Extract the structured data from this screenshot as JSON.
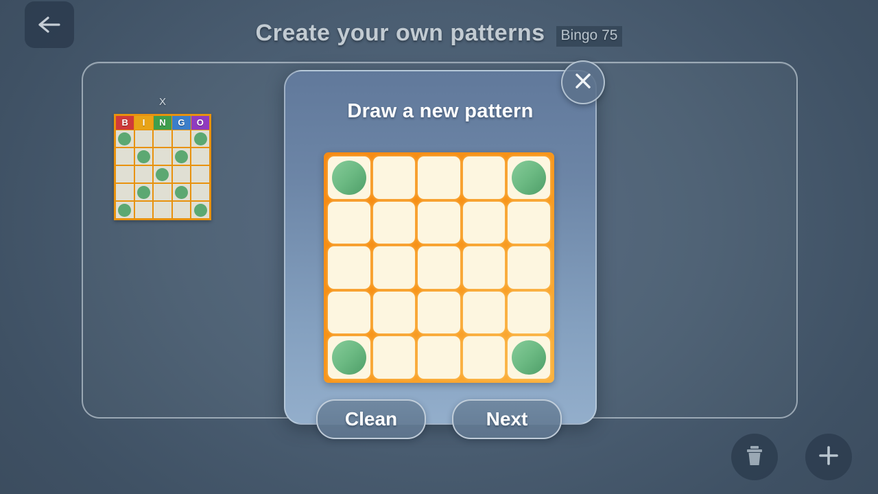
{
  "header": {
    "title": "Create your own patterns",
    "badge": "Bingo 75",
    "back_icon": "arrow-left-icon"
  },
  "saved_patterns": [
    {
      "name": "X",
      "columns": [
        "B",
        "I",
        "N",
        "G",
        "O"
      ],
      "column_colors": [
        "#cf3a3a",
        "#e8a317",
        "#3f9e4d",
        "#3b7ec9",
        "#8f3bbf"
      ],
      "cells": [
        [
          1,
          0,
          0,
          0,
          1
        ],
        [
          0,
          1,
          0,
          1,
          0
        ],
        [
          0,
          0,
          1,
          0,
          0
        ],
        [
          0,
          1,
          0,
          1,
          0
        ],
        [
          1,
          0,
          0,
          0,
          1
        ]
      ]
    }
  ],
  "dialog": {
    "title": "Draw a new pattern",
    "close_icon": "close-icon",
    "grid": {
      "rows": 5,
      "cols": 5,
      "cells": [
        [
          1,
          0,
          0,
          0,
          1
        ],
        [
          0,
          0,
          0,
          0,
          0
        ],
        [
          0,
          0,
          0,
          0,
          0
        ],
        [
          0,
          0,
          0,
          0,
          0
        ],
        [
          1,
          0,
          0,
          0,
          1
        ]
      ]
    },
    "buttons": {
      "clean": "Clean",
      "next": "Next"
    }
  },
  "actions": {
    "delete_icon": "trash-icon",
    "add_icon": "plus-icon"
  },
  "colors": {
    "accent_orange": "#f58a14",
    "cell_cream": "#fdf6e0",
    "dot_green": "#6cba83",
    "background": "#4a5d71"
  }
}
